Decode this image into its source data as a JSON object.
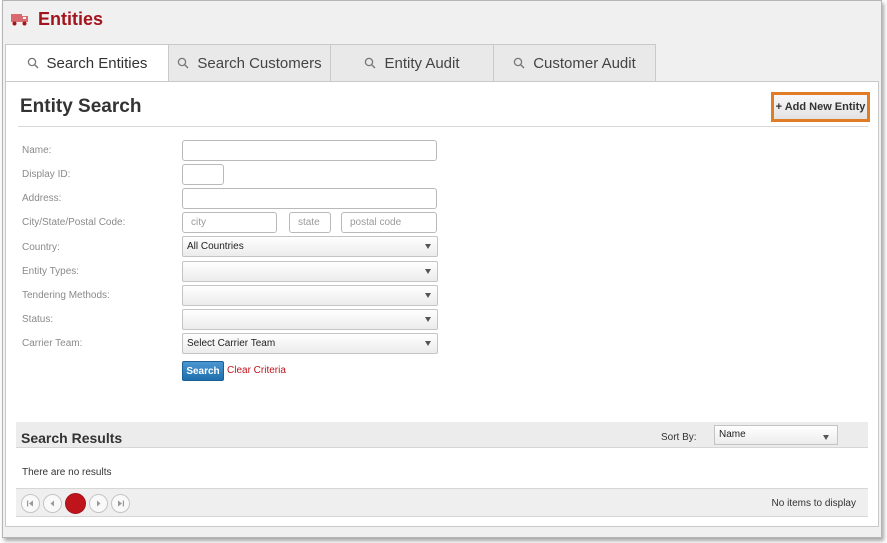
{
  "app": {
    "title": "Entities",
    "icon": "truck-icon",
    "brand_color": "#a3131d"
  },
  "tabs": [
    {
      "label": "Search Entities",
      "active": true,
      "icon": "search-icon"
    },
    {
      "label": "Search Customers",
      "active": false,
      "icon": "search-icon"
    },
    {
      "label": "Entity Audit",
      "active": false,
      "icon": "search-icon"
    },
    {
      "label": "Customer Audit",
      "active": false,
      "icon": "search-icon"
    }
  ],
  "page": {
    "title": "Entity Search",
    "add_button": "+ Add New Entity",
    "accent_color": "#e07b26"
  },
  "form": {
    "name_label": "Name:",
    "display_id_label": "Display ID:",
    "address_label": "Address:",
    "city_state_label": "City/State/Postal Code:",
    "city_placeholder": "city",
    "state_placeholder": "state",
    "postal_placeholder": "postal code",
    "country_label": "Country:",
    "country_value": "All Countries",
    "entity_types_label": "Entity Types:",
    "entity_types_value": "",
    "tendering_label": "Tendering Methods:",
    "tendering_value": "",
    "status_label": "Status:",
    "status_value": "",
    "carrier_team_label": "Carrier Team:",
    "carrier_team_value": "Select Carrier Team",
    "search_button": "Search",
    "clear_link": "Clear Criteria"
  },
  "results": {
    "title": "Search Results",
    "sort_label": "Sort By:",
    "sort_value": "Name",
    "empty_text": "There are no results",
    "pager_info": "No items to display"
  }
}
